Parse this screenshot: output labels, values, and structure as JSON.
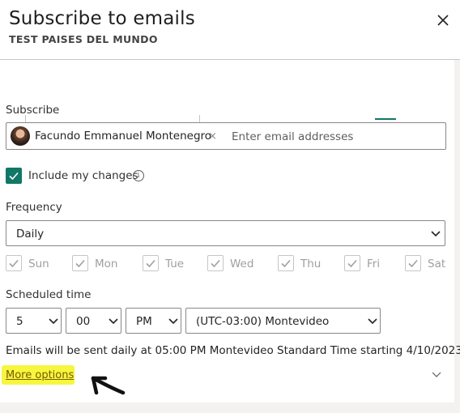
{
  "header": {
    "title": "Subscribe to emails",
    "subtitle": "TEST PAISES DEL MUNDO"
  },
  "subscribe": {
    "label": "Subscribe",
    "recipient_name": "Facundo Emmanuel Montenegro",
    "remove_symbol": "×",
    "placeholder": "Enter email addresses"
  },
  "include_changes": {
    "label": "Include my changes",
    "checked": true,
    "info_symbol": "i"
  },
  "frequency": {
    "label": "Frequency",
    "value": "Daily"
  },
  "days": [
    {
      "label": "Sun",
      "checked": true
    },
    {
      "label": "Mon",
      "checked": true
    },
    {
      "label": "Tue",
      "checked": true
    },
    {
      "label": "Wed",
      "checked": true
    },
    {
      "label": "Thu",
      "checked": true
    },
    {
      "label": "Fri",
      "checked": true
    },
    {
      "label": "Sat",
      "checked": true
    }
  ],
  "schedule": {
    "label": "Scheduled time",
    "hour": "5",
    "minute": "00",
    "ampm": "PM",
    "timezone": "(UTC-03:00) Montevideo"
  },
  "notice": "Emails will be sent daily at 05:00 PM Montevideo Standard Time starting 4/10/2023.",
  "more_options": "More options",
  "colors": {
    "accent": "#117865",
    "highlight": "#f6f63e",
    "disabled": "#a19f9d"
  },
  "icons": [
    "close-icon",
    "checkmark-icon",
    "info-icon",
    "chevron-down-icon",
    "avatar",
    "arrow-annotation-icon"
  ]
}
